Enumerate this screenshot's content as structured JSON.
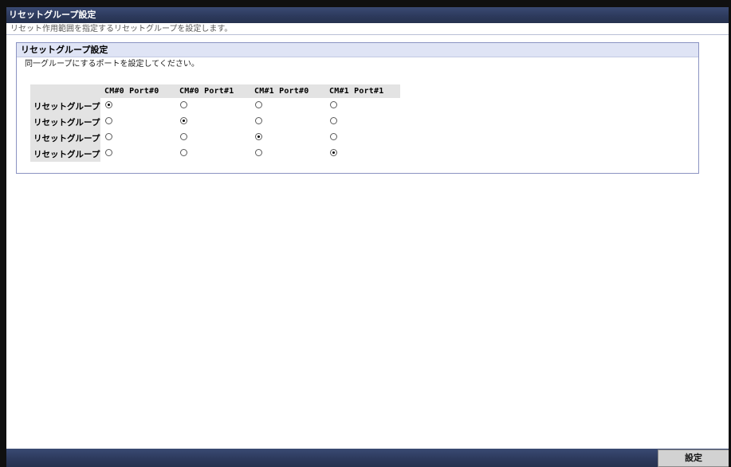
{
  "window": {
    "title": "リセットグループ設定",
    "subtitle": "リセット作用範囲を指定するリセットグループを設定します。"
  },
  "panel": {
    "header": "リセットグループ設定",
    "description": "同一グループにするポートを設定してください。",
    "columns": [
      "CM#0 Port#0",
      "CM#0 Port#1",
      "CM#1 Port#0",
      "CM#1 Port#1"
    ],
    "rows": [
      {
        "label": "リセットグループ",
        "selected_column": 0
      },
      {
        "label": "リセットグループ",
        "selected_column": 1
      },
      {
        "label": "リセットグループ",
        "selected_column": 2
      },
      {
        "label": "リセットグループ",
        "selected_column": 3
      }
    ]
  },
  "footer": {
    "set_button_label": "設定"
  },
  "colors": {
    "title_bar": "#2d3a5d",
    "panel_header": "#dfe4f5",
    "panel_border": "#8b93c2",
    "grid_header": "#e3e3e3"
  }
}
